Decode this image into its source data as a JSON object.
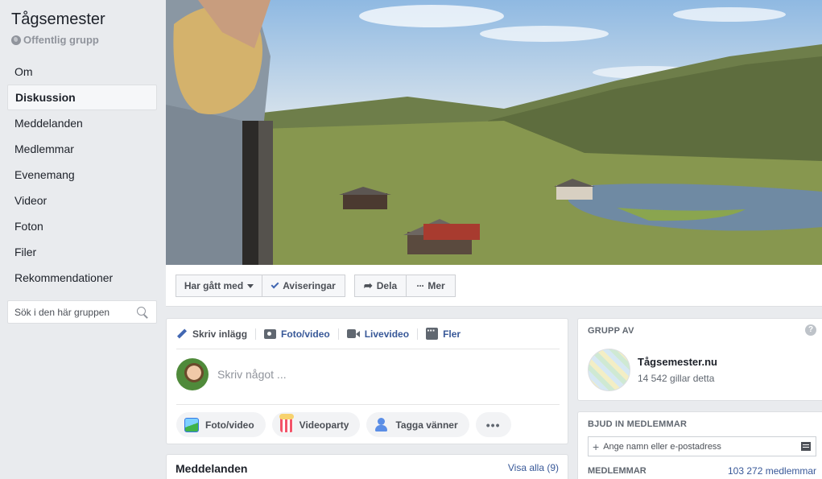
{
  "group": {
    "title": "Tågsemester",
    "privacy": "Offentlig grupp"
  },
  "sidebar": {
    "items": [
      {
        "label": "Om"
      },
      {
        "label": "Diskussion"
      },
      {
        "label": "Meddelanden"
      },
      {
        "label": "Medlemmar"
      },
      {
        "label": "Evenemang"
      },
      {
        "label": "Videor"
      },
      {
        "label": "Foton"
      },
      {
        "label": "Filer"
      },
      {
        "label": "Rekommendationer"
      }
    ],
    "search_placeholder": "Sök i den här gruppen"
  },
  "actions": {
    "joined": "Har gått med",
    "notifications": "Aviseringar",
    "share": "Dela",
    "more": "Mer"
  },
  "composer": {
    "tabs": {
      "write": "Skriv inlägg",
      "photo_video": "Foto/video",
      "live_video": "Livevideo",
      "more": "Fler"
    },
    "placeholder": "Skriv något ...",
    "quick": {
      "photo_video": "Foto/video",
      "video_party": "Videoparty",
      "tag_friends": "Tagga vänner",
      "more": "•••"
    }
  },
  "announcements": {
    "title": "Meddelanden",
    "see_all": "Visa alla (9)"
  },
  "group_by": {
    "header": "GRUPP AV",
    "help": "?",
    "page_name": "Tågsemester.nu",
    "likes": "14 542 gillar detta"
  },
  "invite": {
    "header": "BJUD IN MEDLEMMAR",
    "placeholder": "Ange namn eller e-postadress",
    "members_header": "MEDLEMMAR",
    "members_count": "103 272 medlemmar"
  },
  "colors": {
    "link": "#385898",
    "background": "#e9ebee",
    "accent": "#4267b2"
  }
}
